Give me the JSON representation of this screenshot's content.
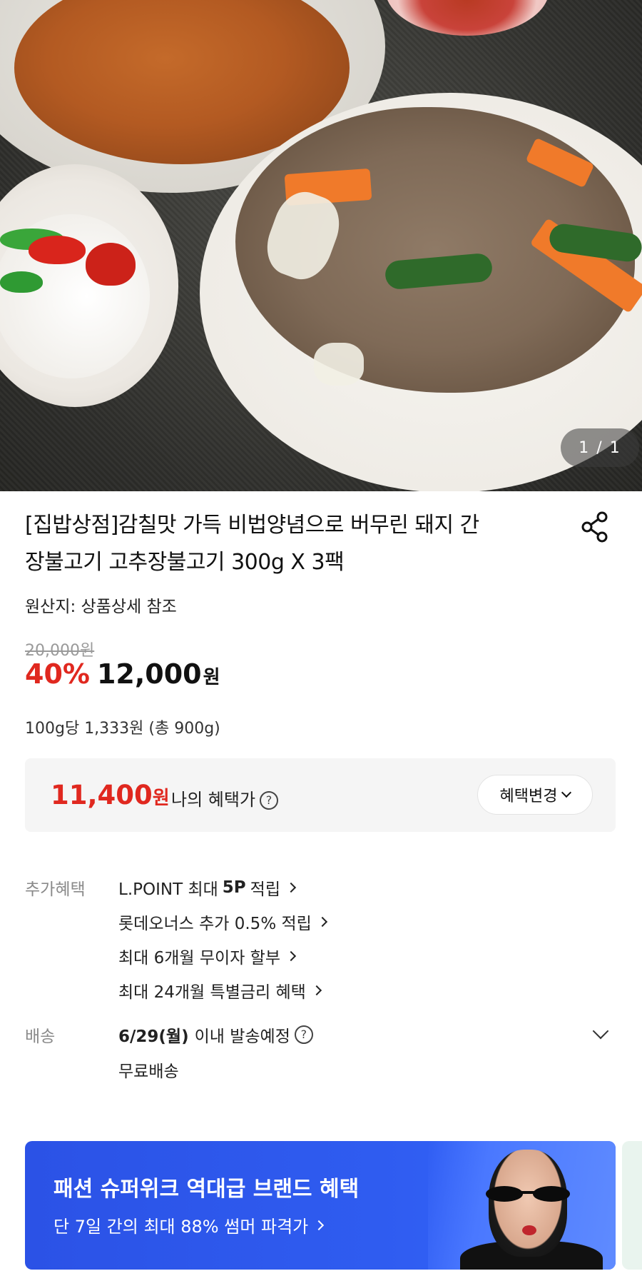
{
  "gallery": {
    "pager_text": "1 / 1"
  },
  "product": {
    "title_line1": "[집밥상점]감칠맛 가득 비법양념으로 버무린 돼지 간",
    "title_line2": "장불고기 고추장불고기 300g X 3팩",
    "origin": "원산지: 상품상세 참조",
    "original_price": "20,000원",
    "discount_rate": "40%",
    "sale_price": "12,000",
    "sale_price_unit": "원",
    "unit_price": "100g당 1,333원 (총 900g)"
  },
  "benefit": {
    "price": "11,400",
    "price_unit": "원",
    "label": "나의 혜택가",
    "help": "?",
    "change_button": "혜택변경"
  },
  "extra_benefits": {
    "label": "추가혜택",
    "items": [
      {
        "pre": "L.POINT 최대",
        "bold": "5P",
        "post": "적립"
      },
      {
        "text": "롯데오너스 추가 0.5% 적립"
      },
      {
        "text": "최대 6개월 무이자 할부"
      },
      {
        "text": "최대 24개월 특별금리 혜택"
      }
    ]
  },
  "shipping": {
    "label": "배송",
    "date": "6/29(월)",
    "date_suffix": "이내 발송예정",
    "help": "?",
    "fee": "무료배송"
  },
  "banner": {
    "title": "패션 슈퍼위크 역대급 브랜드 혜택",
    "subtitle": "단 7일 간의 최대 88% 썸머 파격가"
  },
  "colors": {
    "discount_red": "#e0281f",
    "banner_blue": "#2f5cf0",
    "muted_gray": "#8a8a8a"
  }
}
